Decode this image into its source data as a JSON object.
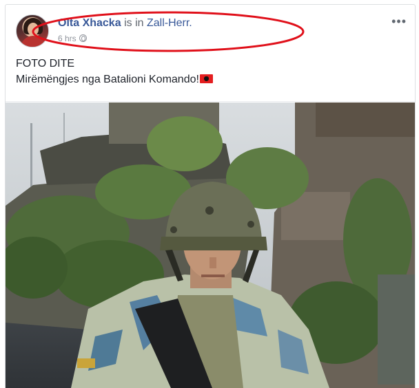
{
  "post": {
    "author_name": "Olta Xhacka",
    "location_prefix": "is in",
    "location": "Zall-Herr.",
    "timestamp": "6 hrs",
    "privacy_icon": "globe-icon",
    "more_label": "•••",
    "text_line1": "FOTO DITE",
    "text_line2": "Mirëmëngjes nga Batalioni Komando!",
    "flag_icon": "albania-flag-icon"
  },
  "colors": {
    "link": "#385898",
    "text": "#1d2129",
    "meta": "#90949c",
    "annotation": "#e0101a"
  }
}
